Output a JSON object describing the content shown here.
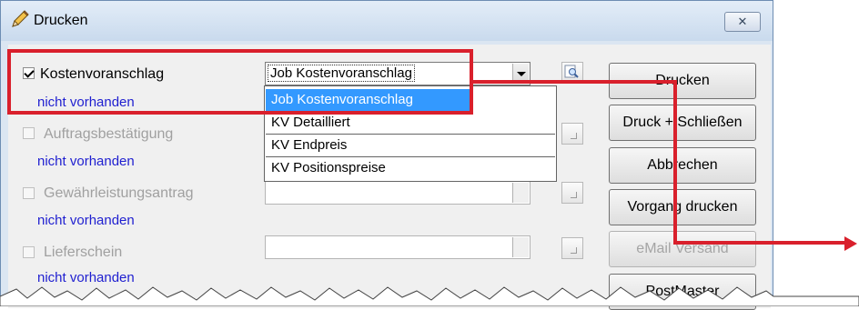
{
  "window": {
    "title": "Drucken",
    "close_label": "✕"
  },
  "rows": [
    {
      "label": "Kostenvoranschlag",
      "checked": true,
      "enabled": true,
      "status": "nicht vorhanden",
      "combo_value": "Job Kostenvoranschlag"
    },
    {
      "label": "Auftragsbestätigung",
      "checked": false,
      "enabled": false,
      "status": "nicht vorhanden",
      "combo_value": ""
    },
    {
      "label": "Gewährleistungsantrag",
      "checked": false,
      "enabled": false,
      "status": "nicht vorhanden",
      "combo_value": ""
    },
    {
      "label": "Lieferschein",
      "checked": false,
      "enabled": false,
      "status": "nicht vorhanden",
      "combo_value": ""
    }
  ],
  "dropdown": {
    "options": [
      "Job Kostenvoranschlag",
      "KV Detailliert",
      "KV Endpreis",
      "KV Positionspreise"
    ],
    "selected": "Job Kostenvoranschlag"
  },
  "buttons": {
    "print": "Drucken",
    "print_close": "Druck + Schließen",
    "cancel": "Abbrechen",
    "print_process": "Vorgang drucken",
    "email": "eMail Versand",
    "postmaster": "PostMaster"
  },
  "colors": {
    "highlight": "#d9202c",
    "status_link": "#1f1fd0",
    "selection": "#3399ff"
  },
  "icons": {
    "title": "pencil-icon",
    "browse": "magnifier-icon"
  }
}
